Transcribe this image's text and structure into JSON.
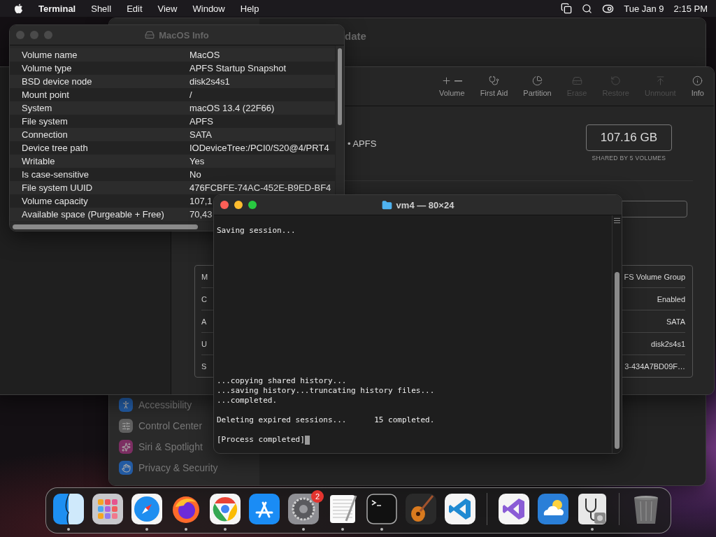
{
  "menu_bar": {
    "app": "Terminal",
    "menus": [
      "Shell",
      "Edit",
      "View",
      "Window",
      "Help"
    ],
    "date": "Tue Jan 9",
    "time": "2:15 PM"
  },
  "settings_window": {
    "title": "date",
    "sidebar_items": [
      {
        "label": "Accessibility",
        "kind": "accessibility"
      },
      {
        "label": "Control Center",
        "kind": "control"
      },
      {
        "label": "Siri & Spotlight",
        "kind": "siri"
      },
      {
        "label": "Privacy & Security",
        "kind": "privacy"
      }
    ]
  },
  "disk_utility": {
    "toolbar": [
      {
        "label": "Volume",
        "kind": "volume",
        "disabled": false
      },
      {
        "label": "First Aid",
        "kind": "firstaid",
        "disabled": false
      },
      {
        "label": "Partition",
        "kind": "partition",
        "disabled": false
      },
      {
        "label": "Erase",
        "kind": "erase",
        "disabled": true
      },
      {
        "label": "Restore",
        "kind": "restore",
        "disabled": true
      },
      {
        "label": "Unmount",
        "kind": "unmount",
        "disabled": true
      },
      {
        "label": "Info",
        "kind": "info",
        "disabled": false
      }
    ],
    "format": "• APFS",
    "capacity": "107.16 GB",
    "capacity_note": "SHARED BY 5 VOLUMES",
    "info_rows": [
      {
        "label": "M",
        "value": "FS Volume Group"
      },
      {
        "label": "C",
        "value": "Enabled"
      },
      {
        "label": "A",
        "value": "SATA"
      },
      {
        "label": "U",
        "value": "disk2s4s1"
      },
      {
        "label": "S",
        "value": "3-434A7BD09F…"
      }
    ]
  },
  "info_window": {
    "title": "MacOS Info",
    "active": false,
    "rows": [
      {
        "label": "Volume name",
        "value": "MacOS"
      },
      {
        "label": "Volume type",
        "value": "APFS Startup Snapshot"
      },
      {
        "label": "BSD device node",
        "value": "disk2s4s1"
      },
      {
        "label": "Mount point",
        "value": "/"
      },
      {
        "label": "System",
        "value": "macOS 13.4 (22F66)"
      },
      {
        "label": "File system",
        "value": "APFS"
      },
      {
        "label": "Connection",
        "value": "SATA"
      },
      {
        "label": "Device tree path",
        "value": "IODeviceTree:/PCI0/S20@4/PRT4"
      },
      {
        "label": "Writable",
        "value": "Yes"
      },
      {
        "label": "Is case-sensitive",
        "value": "No"
      },
      {
        "label": "File system UUID",
        "value": "476FCBFE-74AC-452E-B9ED-BF4"
      },
      {
        "label": "Volume capacity",
        "value": "107,1"
      },
      {
        "label": "Available space (Purgeable + Free)",
        "value": "70,43"
      }
    ]
  },
  "terminal": {
    "title": "vm4 — 80×24",
    "active": true,
    "blocks": [
      [
        "Saving session..."
      ],
      [
        "...copying shared history...",
        "...saving history...truncating history files...",
        "...completed."
      ],
      [
        "Deleting expired sessions...      15 completed."
      ],
      [
        "[Process completed]"
      ]
    ]
  },
  "dock": {
    "items": [
      {
        "kind": "finder",
        "running": true
      },
      {
        "kind": "launchpad",
        "running": false
      },
      {
        "kind": "safari",
        "running": true
      },
      {
        "kind": "firefox",
        "running": true
      },
      {
        "kind": "chrome",
        "running": true
      },
      {
        "kind": "appstore",
        "running": false
      },
      {
        "kind": "settings",
        "running": true,
        "badge": "2"
      },
      {
        "kind": "textedit",
        "running": true
      },
      {
        "kind": "terminal",
        "running": true
      },
      {
        "kind": "guitar",
        "running": false
      },
      {
        "kind": "vscode",
        "running": false
      },
      {
        "kind": "separator"
      },
      {
        "kind": "studio",
        "running": false
      },
      {
        "kind": "weather",
        "running": false
      },
      {
        "kind": "diskutil",
        "running": true
      },
      {
        "kind": "separator"
      },
      {
        "kind": "trash",
        "running": false
      }
    ]
  }
}
